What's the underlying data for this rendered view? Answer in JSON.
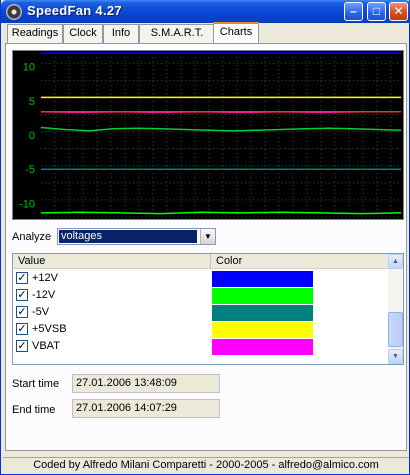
{
  "window": {
    "title": "SpeedFan 4.27",
    "minimize_glyph": "–",
    "maximize_glyph": "□",
    "close_glyph": "✕"
  },
  "tabs": [
    {
      "label": "Readings",
      "active": false
    },
    {
      "label": "Clock",
      "active": false
    },
    {
      "label": "Info",
      "active": false
    },
    {
      "label": "S.M.A.R.T.",
      "active": false
    },
    {
      "label": "Charts",
      "active": true
    }
  ],
  "chart_data": {
    "type": "line",
    "background": "#000000",
    "ylim": [
      -12,
      12
    ],
    "yticks": [
      10,
      5,
      0,
      -5,
      -10
    ],
    "ytick_labels": [
      "10",
      "5",
      "0",
      "-5",
      "-10"
    ],
    "grid": true,
    "series": [
      {
        "key": "+12V",
        "color": "#0000ff",
        "values": [
          12.0,
          12.0
        ]
      },
      {
        "key": "-12V",
        "color": "#00ff00",
        "values": [
          -11.4,
          -11.3,
          -11.4,
          -11.5,
          -11.3,
          -11.4,
          -11.3,
          -11.4,
          -11.5,
          -11.4
        ]
      },
      {
        "key": "-5V",
        "color": "#008080",
        "values": [
          -5.0,
          -5.0
        ]
      },
      {
        "key": "+5VSB",
        "color": "#ffff00",
        "values": [
          5.5,
          5.5
        ]
      },
      {
        "key": "VBAT",
        "color": "#ff00ff",
        "values": [
          3.4,
          3.3,
          3.4,
          3.3,
          3.4,
          3.3,
          3.4,
          3.3,
          3.4,
          3.4
        ]
      },
      {
        "key": "red",
        "color": "#ff3030",
        "values": [
          3.4,
          3.4
        ]
      },
      {
        "key": "green-low",
        "color": "#00cc40",
        "values": [
          1.1,
          0.8,
          0.6,
          0.9,
          1.0,
          0.9,
          0.8,
          0.7,
          0.6,
          0.7,
          0.8,
          0.9,
          1.0,
          0.9,
          0.8,
          0.7
        ]
      }
    ]
  },
  "analyze": {
    "label": "Analyze",
    "selected": "voltages",
    "dropdown_glyph": "▼"
  },
  "list": {
    "headers": {
      "value": "Value",
      "color": "Color"
    },
    "check_glyph": "✓",
    "rows": [
      {
        "label": "+12V",
        "checked": true,
        "color": "#0000ff"
      },
      {
        "label": "-12V",
        "checked": true,
        "color": "#00ff00"
      },
      {
        "label": "-5V",
        "checked": true,
        "color": "#008080"
      },
      {
        "label": "+5VSB",
        "checked": true,
        "color": "#ffff00"
      },
      {
        "label": "VBAT",
        "checked": true,
        "color": "#ff00ff"
      }
    ],
    "scroll_up_glyph": "▲",
    "scroll_down_glyph": "▼"
  },
  "times": {
    "start_label": "Start time",
    "start_value": "27.01.2006 13:48:09",
    "end_label": "End time",
    "end_value": "27.01.2006 14:07:29"
  },
  "statusbar": {
    "text": "Coded by Alfredo Milani Comparetti - 2000-2005 - alfredo@almico.com"
  }
}
